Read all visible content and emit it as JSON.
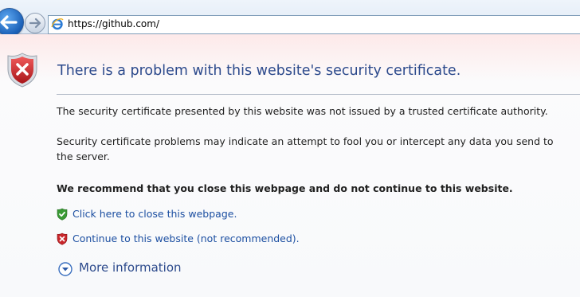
{
  "browser": {
    "url": "https://github.com/"
  },
  "error_page": {
    "title": "There is a problem with this website's security certificate.",
    "paragraph1": "The security certificate presented by this website was not issued by a trusted certificate authority.",
    "paragraph2": "Security certificate problems may indicate an attempt to fool you or intercept any data you send to the server.",
    "recommendation": "We recommend that you close this webpage and do not continue to this website.",
    "close_link": "Click here to close this webpage.",
    "continue_link": "Continue to this website (not recommended).",
    "more_info": "More information"
  },
  "icons": {
    "back": "back-arrow-icon",
    "forward": "forward-arrow-icon",
    "browser": "internet-explorer-icon",
    "error_shield": "error-shield-icon",
    "safe_shield": "green-shield-icon",
    "warning_shield": "red-shield-icon",
    "expand": "expand-chevron-icon"
  },
  "colors": {
    "title": "#2c4a8c",
    "link": "#1c4fa1",
    "error_red": "#c9262a",
    "safe_green": "#3a9a35"
  }
}
